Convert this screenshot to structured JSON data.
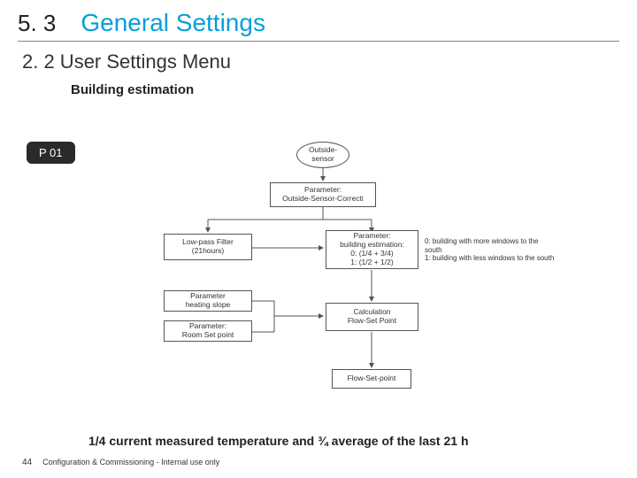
{
  "header": {
    "number": "5. 3",
    "title": "General Settings"
  },
  "subtitle": "2. 2 User Settings Menu",
  "section_label": "Building estimation",
  "badge": "P 01",
  "diagram": {
    "outside_sensor": "Outside-\nsensor",
    "param_correction": "Parameter:\nOutside-Sensor-Correcti",
    "low_pass": "Low-pass Filter\n(21hours)",
    "building_estimation": "Parameter:\nbuilding estimation:\n0: (1/4 + 3/4)\n1: (1/2 + 1/2)",
    "side_note": "0: building with more windows to the south\n1: building with less windows to the south",
    "heating_slope": "Parameter\nheating slope",
    "room_setpoint": "Parameter:\nRoom Set point",
    "calc_flow": "Calculation\nFlow-Set Point",
    "flow_setpoint": "Flow-Set-point"
  },
  "bottom_text": "1/4 current measured temperature and ¾ average of the last 21 h",
  "footer": {
    "page": "44",
    "note": "Configuration & Commissioning - Internal use only"
  }
}
